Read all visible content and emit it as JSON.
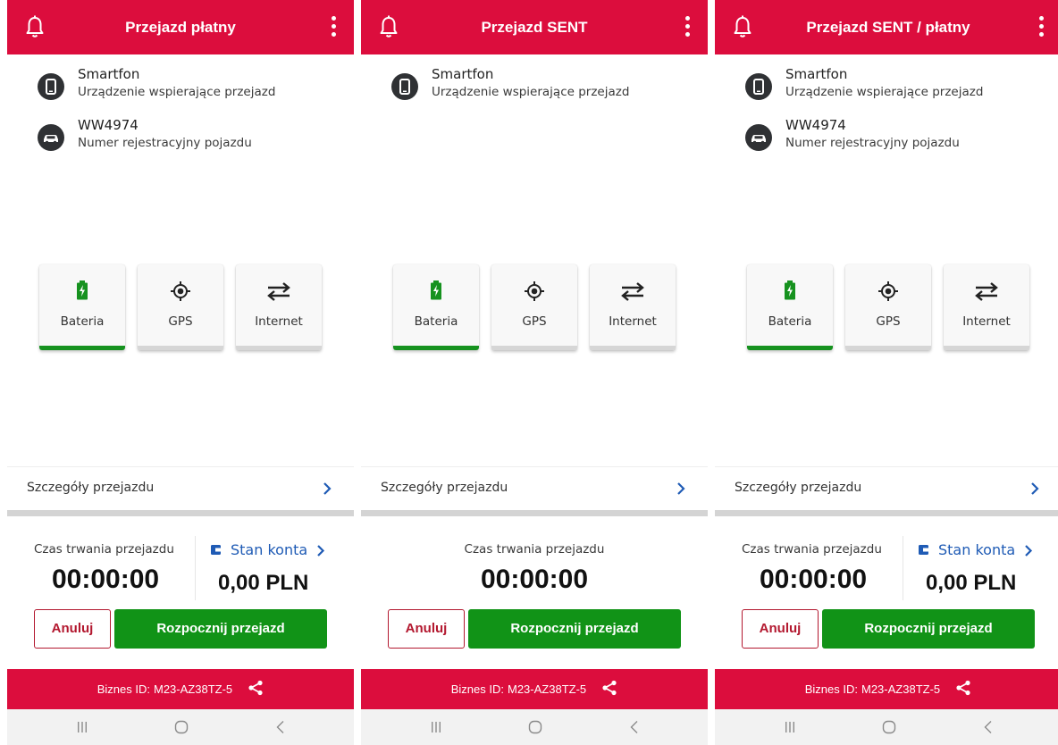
{
  "screens": [
    {
      "title": "Przejazd płatny",
      "device": {
        "name": "Smartfon",
        "desc": "Urządzenie wspierające przejazd"
      },
      "vehicle": {
        "plate": "WW4974",
        "desc": "Numer rejestracyjny pojazdu"
      },
      "tiles": {
        "battery": "Bateria",
        "gps": "GPS",
        "internet": "Internet"
      },
      "details_label": "Szczegóły przejazdu",
      "duration_label": "Czas trwania przejazdu",
      "duration_value": "00:00:00",
      "account_label": "Stan konta",
      "balance": "0,00 PLN",
      "cancel_label": "Anuluj",
      "start_label": "Rozpocznij przejazd",
      "business_id_label": "Biznes ID:",
      "business_id": "M23-AZ38TZ-5"
    },
    {
      "title": "Przejazd SENT",
      "device": {
        "name": "Smartfon",
        "desc": "Urządzenie wspierające przejazd"
      },
      "tiles": {
        "battery": "Bateria",
        "gps": "GPS",
        "internet": "Internet"
      },
      "details_label": "Szczegóły przejazdu",
      "duration_label": "Czas trwania przejazdu",
      "duration_value": "00:00:00",
      "cancel_label": "Anuluj",
      "start_label": "Rozpocznij przejazd",
      "business_id_label": "Biznes ID:",
      "business_id": "M23-AZ38TZ-5"
    },
    {
      "title": "Przejazd SENT / płatny",
      "device": {
        "name": "Smartfon",
        "desc": "Urządzenie wspierające przejazd"
      },
      "vehicle": {
        "plate": "WW4974",
        "desc": "Numer rejestracyjny pojazdu"
      },
      "tiles": {
        "battery": "Bateria",
        "gps": "GPS",
        "internet": "Internet"
      },
      "details_label": "Szczegóły przejazdu",
      "duration_label": "Czas trwania przejazdu",
      "duration_value": "00:00:00",
      "account_label": "Stan konta",
      "balance": "0,00 PLN",
      "cancel_label": "Anuluj",
      "start_label": "Rozpocznij przejazd",
      "business_id_label": "Biznes ID:",
      "business_id": "M23-AZ38TZ-5"
    }
  ],
  "status": {
    "battery": "ok",
    "gps": "neutral",
    "internet": "neutral"
  },
  "icons": {
    "header_left": "bell-icon",
    "header_right": "more-vertical-icon",
    "device": "smartphone-icon",
    "vehicle": "car-icon",
    "battery": "battery-charging-icon",
    "gps": "gps-target-icon",
    "internet": "swap-arrows-icon",
    "details": "chevron-right-icon",
    "account": "wallet-icon",
    "share": "share-icon",
    "nav": [
      "recent-apps-icon",
      "home-icon",
      "back-icon"
    ]
  },
  "colors": {
    "brand_red": "#dc0d3d",
    "start_green": "#119317",
    "battery_ok": "#16921f",
    "link_blue": "#1f5bb5",
    "cancel_red": "#b3182f"
  }
}
